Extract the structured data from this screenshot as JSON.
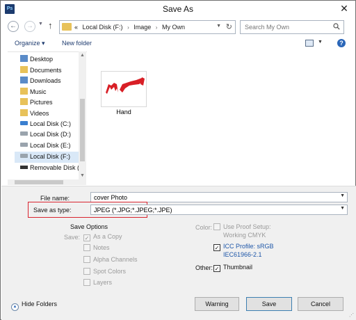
{
  "window": {
    "title": "Save As",
    "app_icon": "Ps",
    "close": "✕"
  },
  "nav": {
    "back": "←",
    "forward": "→",
    "up": "↑",
    "breadcrumb": [
      "«",
      "Local Disk (F:)",
      "Image",
      "My Own"
    ],
    "search_placeholder": "Search My Own"
  },
  "toolbar": {
    "organize": "Organize ▾",
    "new_folder": "New folder",
    "help": "?"
  },
  "sidebar": {
    "items": [
      {
        "label": "Desktop",
        "icon": "folder-blue-icon"
      },
      {
        "label": "Documents",
        "icon": "folder-icon"
      },
      {
        "label": "Downloads",
        "icon": "downloads-icon"
      },
      {
        "label": "Music",
        "icon": "music-icon"
      },
      {
        "label": "Pictures",
        "icon": "pictures-icon"
      },
      {
        "label": "Videos",
        "icon": "videos-icon"
      },
      {
        "label": "Local Disk (C:)",
        "icon": "windows-drive-icon"
      },
      {
        "label": "Local Disk (D:)",
        "icon": "drive-icon"
      },
      {
        "label": "Local Disk (E:)",
        "icon": "drive-icon"
      },
      {
        "label": "Local Disk (F:)",
        "icon": "drive-icon",
        "selected": true
      },
      {
        "label": "Removable Disk (",
        "icon": "usb-icon"
      }
    ]
  },
  "files": [
    {
      "name": "Hand",
      "icon": "image-thumbnail"
    }
  ],
  "form": {
    "file_name_label": "File name:",
    "file_name_value": "cover Photo",
    "save_type_label": "Save as type:",
    "save_type_value": "JPEG (*.JPG;*.JPEG;*.JPE)"
  },
  "save_options": {
    "heading": "Save Options",
    "save_label": "Save:",
    "as_copy": "As a Copy",
    "notes": "Notes",
    "alpha": "Alpha Channels",
    "spot": "Spot Colors",
    "layers": "Layers",
    "color_label": "Color:",
    "proof_setup": "Use Proof Setup:",
    "proof_profile": "Working CMYK",
    "icc_profile": "ICC Profile:  sRGB",
    "icc_profile_2": "IEC61966-2.1",
    "other_label": "Other:",
    "thumbnail": "Thumbnail"
  },
  "buttons": {
    "hide_folders": "Hide Folders",
    "warning": "Warning",
    "save": "Save",
    "cancel": "Cancel"
  },
  "accent_red": "#d9232e"
}
